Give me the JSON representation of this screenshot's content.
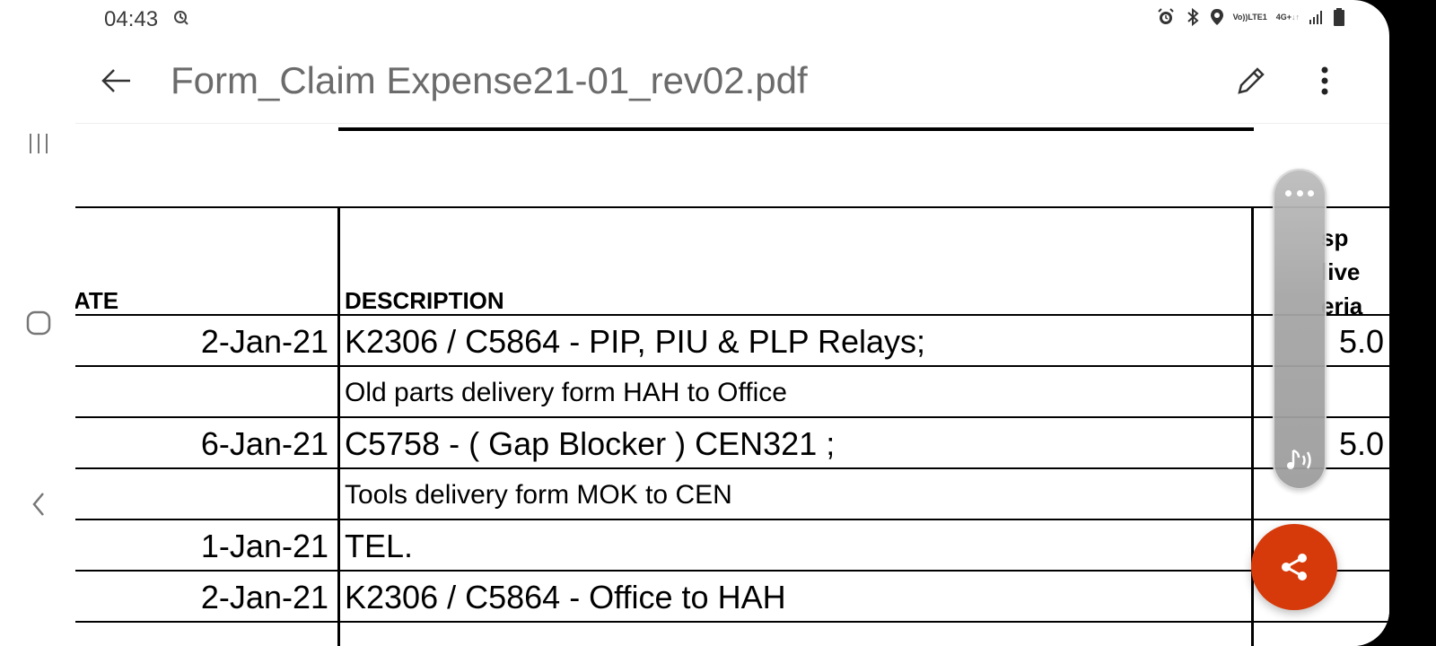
{
  "status_bar": {
    "time": "04:43",
    "network_top": "Vo))",
    "network_bottom": "LTE1",
    "network_type": "4G+",
    "icons": [
      "sync-icon",
      "alarm-icon",
      "bluetooth-icon",
      "location-icon",
      "signal-icon",
      "battery-icon"
    ]
  },
  "app_bar": {
    "title": "Form_Claim Expense21-01_rev02.pdf",
    "icons": [
      "back-arrow-icon",
      "pencil-icon",
      "more-vertical-icon"
    ]
  },
  "table": {
    "headers": {
      "date": "DATE",
      "date_visible": "ATE",
      "description": "DESCRIPTION",
      "extra_lines": [
        "sp",
        "live",
        "eria"
      ]
    },
    "rows": [
      {
        "date": "2-Jan-21",
        "description": "K2306 / C5864  - PIP, PIU & PLP Relays;",
        "extra": "5.0",
        "style": "big"
      },
      {
        "date": "",
        "description": "Old parts delivery form HAH to Office",
        "extra": "",
        "style": "small"
      },
      {
        "date": "6-Jan-21",
        "description": "C5758  - ( Gap Blocker ) CEN321 ;",
        "extra": "5.0",
        "style": "big"
      },
      {
        "date": "",
        "description": "Tools delivery form MOK to CEN",
        "extra": "",
        "style": "small"
      },
      {
        "date": "1-Jan-21",
        "description": "TEL.",
        "extra": "",
        "style": "big"
      },
      {
        "date": "2-Jan-21",
        "description": "K2306 / C5864  - Office  to HAH",
        "extra": "",
        "style": "big"
      }
    ]
  },
  "floating_panel": {
    "icons": [
      "more-horizontal-icon",
      "read-aloud-icon"
    ]
  },
  "fab": {
    "icon": "share-icon",
    "color": "#d63a0a"
  },
  "system_nav": {
    "icons": [
      "recents-icon",
      "home-icon",
      "back-icon"
    ]
  }
}
